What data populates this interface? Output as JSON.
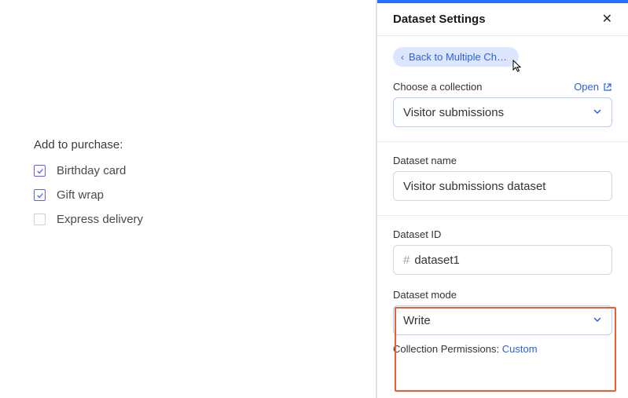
{
  "left": {
    "title": "Add to purchase:",
    "items": [
      {
        "label": "Birthday card",
        "checked": true
      },
      {
        "label": "Gift wrap",
        "checked": true
      },
      {
        "label": "Express delivery",
        "checked": false
      }
    ]
  },
  "panel": {
    "title": "Dataset Settings",
    "back_label": "Back to Multiple Choi…",
    "collection": {
      "label": "Choose a collection",
      "open_label": "Open",
      "value": "Visitor submissions"
    },
    "dataset_name": {
      "label": "Dataset name",
      "value": "Visitor submissions dataset"
    },
    "dataset_id": {
      "label": "Dataset ID",
      "prefix": "#",
      "value": "dataset1"
    },
    "dataset_mode": {
      "label": "Dataset mode",
      "value": "Write"
    },
    "permissions": {
      "label": "Collection Permissions:",
      "value": "Custom"
    }
  }
}
